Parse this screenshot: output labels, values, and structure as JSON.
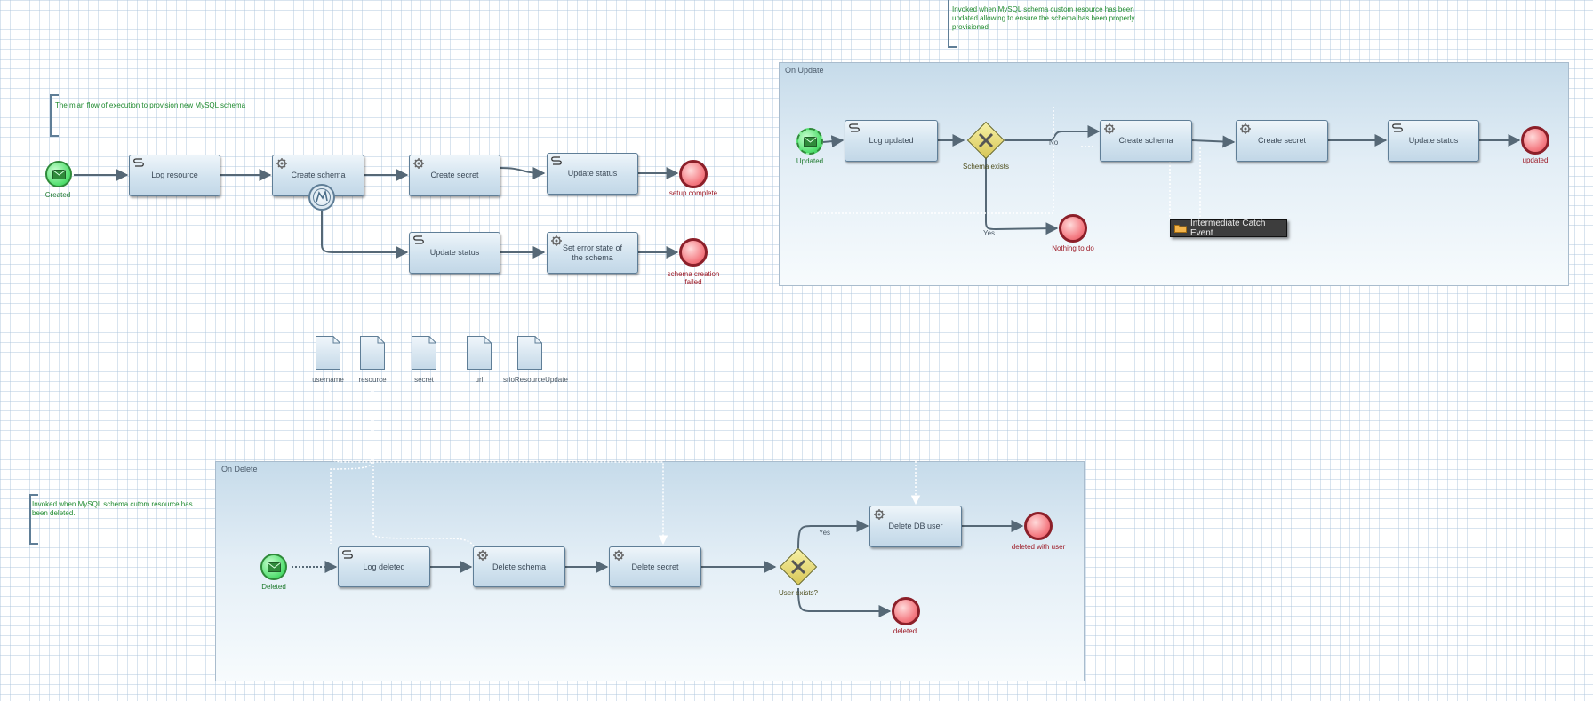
{
  "colors": {
    "start": "#4fde6c",
    "end": "#f58087",
    "gateway": "#e4d36b",
    "task": "#d2e3ef",
    "note_text": "#1e8a2e",
    "flow": "#566876"
  },
  "notes": {
    "main": "The mian flow of execution to provision new MySQL schema",
    "update": "Invoked when MySQL schema custom resource has been updated allowing to ensure the schema has been properly provisioned",
    "delete": "Invoked when MySQL schema cutom resource has been deleted."
  },
  "main_flow": {
    "start": "Created",
    "tasks": {
      "log_resource": "Log resource",
      "create_schema": "Create schema",
      "create_secret": "Create secret",
      "update_status": "Update status",
      "update_status_error": "Update status",
      "set_error_state": "Set error state of the schema"
    },
    "ends": {
      "setup_complete": "setup complete",
      "creation_failed": "schema creation failed"
    }
  },
  "data_objects": [
    "username",
    "resource",
    "secret",
    "url",
    "srioResourceUpdate"
  ],
  "on_update": {
    "title": "On Update",
    "start": "Updated",
    "tasks": {
      "log_updated": "Log updated",
      "create_schema": "Create schema",
      "create_secret": "Create secret",
      "update_status": "Update status"
    },
    "gateway": "Schema exists",
    "flow_no": "No",
    "flow_yes": "Yes",
    "ends": {
      "updated": "updated",
      "nothing": "Nothing to do"
    },
    "tooltip": "Intermediate Catch Event"
  },
  "on_delete": {
    "title": "On Delete",
    "start": "Deleted",
    "tasks": {
      "log_deleted": "Log deleted",
      "delete_schema": "Delete schema",
      "delete_secret": "Delete secret",
      "delete_db_user": "Delete DB user"
    },
    "gateway": "User exists?",
    "flow_yes": "Yes",
    "ends": {
      "with_user": "deleted with user",
      "deleted": "deleted"
    }
  }
}
